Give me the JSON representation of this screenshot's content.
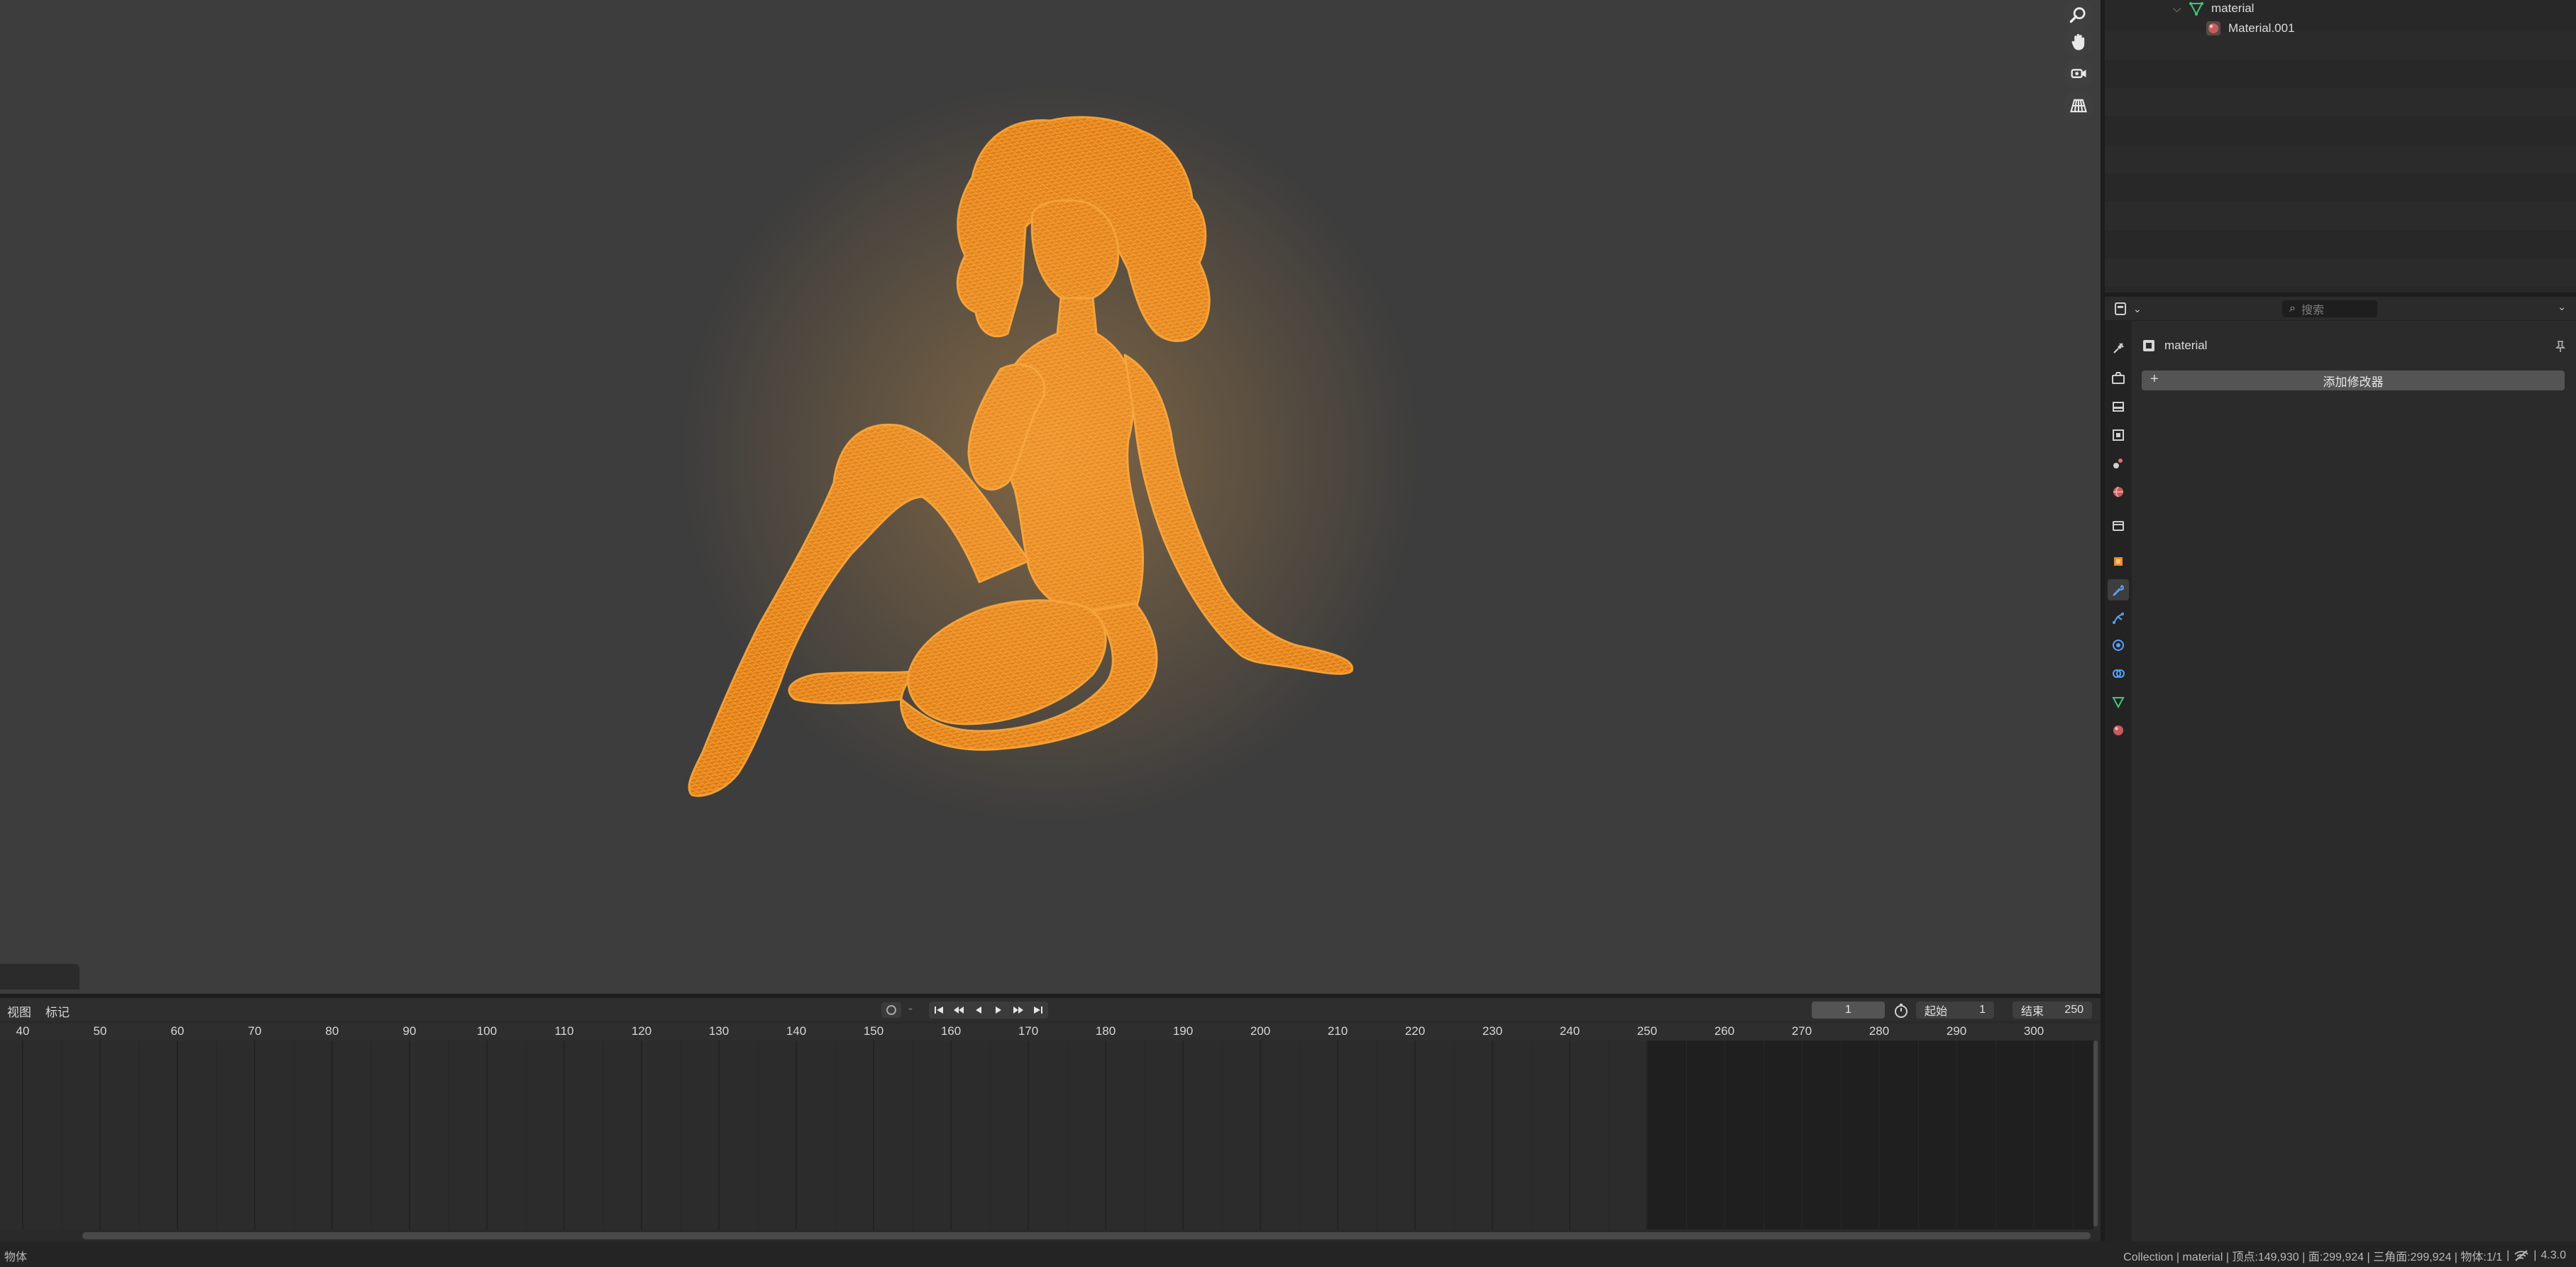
{
  "viewport": {
    "nav_buttons": [
      "zoom-icon",
      "hand-pan-icon",
      "orbit-camera-icon",
      "perspective-grid-icon"
    ],
    "model_color": "#f0921e"
  },
  "outliner": {
    "rows": [
      {
        "label": "material",
        "icon": "mesh-data-icon",
        "color": "#3fc67c"
      },
      {
        "label": "Material.001",
        "icon": "material-sphere-icon",
        "color": "#c75c5c"
      }
    ]
  },
  "properties": {
    "search_placeholder": "搜索",
    "object_name": "material",
    "add_modifier_label": "添加修改器",
    "tabs": [
      "tool-icon",
      "render-icon",
      "output-icon",
      "view-layer-icon",
      "scene-icon",
      "world-icon",
      "collection-icon",
      "object-icon",
      "modifier-wrench-icon",
      "particles-icon",
      "physics-icon",
      "constraints-icon",
      "object-data-icon",
      "material-icon"
    ],
    "active_tab": "modifier-wrench-icon"
  },
  "timeline": {
    "menu": {
      "view": "视图",
      "marker": "标记"
    },
    "current_frame": "1",
    "start_label": "起始",
    "start_value": "1",
    "end_label": "结束",
    "end_value": "250",
    "ticks": [
      "40",
      "50",
      "60",
      "70",
      "80",
      "90",
      "100",
      "110",
      "120",
      "130",
      "140",
      "150",
      "160",
      "170",
      "180",
      "190",
      "200",
      "210",
      "220",
      "230",
      "240",
      "250",
      "260",
      "270",
      "280",
      "290",
      "300"
    ]
  },
  "statusbar": {
    "left": "物体",
    "right": "Collection | material | 顶点:149,930 | 面:299,924 | 三角面:299,924 | 物体:1/1",
    "version": "4.3.0"
  }
}
